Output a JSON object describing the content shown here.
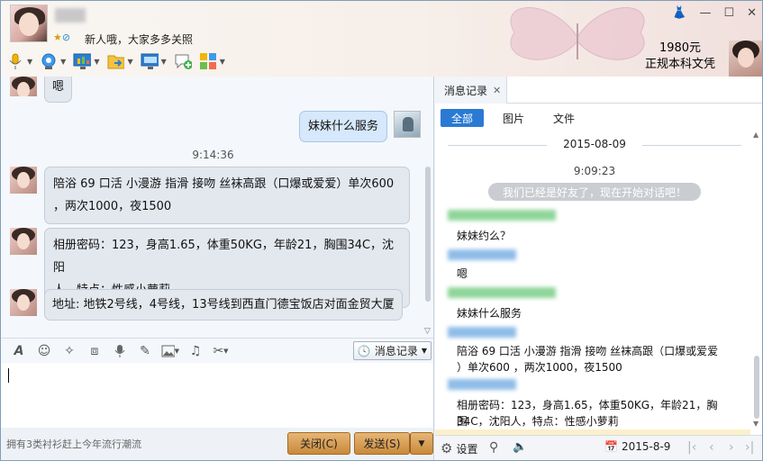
{
  "header": {
    "signature": "新人哦，大家多多关照",
    "ad": {
      "price": "1980元",
      "text": "正规本科文凭"
    },
    "window_buttons": [
      "skin-icon",
      "minimize-icon",
      "maximize-icon",
      "close-icon"
    ],
    "toolbar": [
      "microphone-icon",
      "video-call-icon",
      "screen-share-icon",
      "file-transfer-icon",
      "remote-desktop-icon",
      "create-group-icon",
      "apps-icon"
    ]
  },
  "chat": {
    "partial_msg": "嗯",
    "my_msg": "妹妹什么服务",
    "timestamp": "9:14:36",
    "messages": [
      {
        "line1": "陪浴 69 口活 小漫游 指滑 接吻 丝袜高跟（口爆或爱爱）单次600",
        "line2": "，两次1000，夜1500"
      },
      {
        "line1": "相册密码：123，身高1.65，体重50KG，年龄21，胸围34C，沈阳",
        "line2": "人，特点：性感小萝莉"
      },
      {
        "line1": "地址: 地铁2号线，4号线，13号线到西直门德宝饭店对面金贸大厦"
      }
    ]
  },
  "input_toolbar": {
    "icons": [
      "font-icon",
      "emoji-icon",
      "magic-icon",
      "screenshot-icon",
      "voice-message-icon",
      "edit-icon",
      "image-icon",
      "music-icon",
      "scissors-icon"
    ],
    "history_label": "消息记录"
  },
  "footer": {
    "ad_text": "拥有3类衬衫赶上今年流行潮流",
    "close_label": "关闭(C)",
    "send_label": "发送(S)"
  },
  "history": {
    "tab_label": "消息记录",
    "filters": [
      "全部",
      "图片",
      "文件"
    ],
    "date": "2015-08-09",
    "time": "9:09:23",
    "system_msg": "我们已经是好友了，现在开始对话吧！",
    "msgs": [
      "妹妹约么？",
      "嗯",
      "妹妹什么服务",
      "陪浴 69 口活 小漫游 指滑 接吻 丝袜高跟（口爆或爱爱",
      "）单次600 ，两次1000，夜1500",
      "相册密码：123，身高1.65，体重50KG，年龄21，胸围",
      "34C，沈阳人，特点：性感小萝莉"
    ],
    "settings_label": "设置",
    "date_label": "2015-8-9"
  },
  "colors": {
    "accent": "#2a7ad4",
    "send_button": "#d39a52",
    "my_bubble": "#d6e8fb",
    "their_bubble": "#e3e8ef"
  }
}
